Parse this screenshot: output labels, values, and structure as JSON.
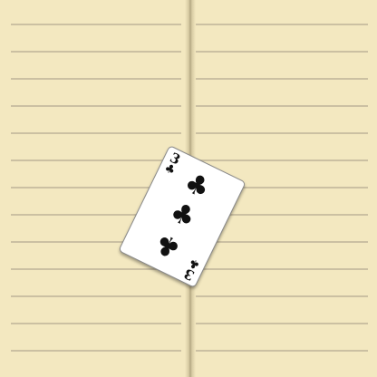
{
  "notebook": {
    "background_color": "#f3e8c0",
    "rule_color": "#cbc0a2"
  },
  "card": {
    "rank": "3",
    "suit": "clubs",
    "suit_symbol": "♣",
    "color": "#111111"
  }
}
